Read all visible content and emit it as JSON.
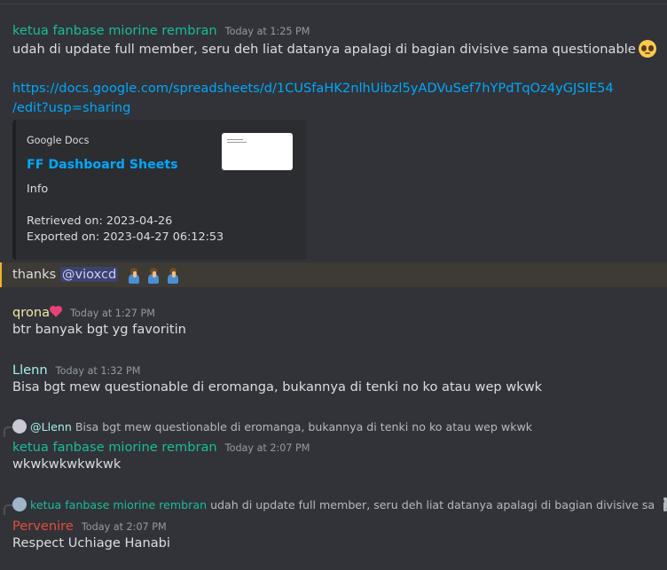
{
  "colors": {
    "background": "#313338",
    "teal_name": "#1abc9c",
    "qrona_name": "#f5e6a8",
    "llenn_name": "#a5f0f0",
    "pervenire_name": "#e74c3c",
    "link": "#00a8fc",
    "mention_highlight": "#f0b232"
  },
  "messages": [
    {
      "author": "ketua fanbase miorine rembran",
      "timestamp": "Today at 1:25 PM",
      "text": "udah di update full member, seru deh liat datanya apalagi di bagian divisive sama questionable",
      "emoji": "pleading-face",
      "link_line1": "https://docs.google.com/spreadsheets/d/1CUSfaHK2nlhUibzl5yADVuSef7hYPdTqOz4yGJSIE54",
      "link_line2": "/edit?usp=sharing",
      "embed": {
        "provider": "Google Docs",
        "title": "FF Dashboard Sheets",
        "description": "Info",
        "retrieved": "Retrieved on: 2023-04-26",
        "exported": "Exported on: 2023-04-27 06:12:53"
      },
      "follow_text": "thanks",
      "mention": "@vioxcd",
      "follow_emoji": "person-praying ×3"
    },
    {
      "author": "qrona",
      "author_emoji": "two-hearts",
      "timestamp": "Today at 1:27 PM",
      "text": "btr banyak bgt yg favoritin"
    },
    {
      "author": "Llenn",
      "timestamp": "Today at 1:32 PM",
      "text": "Bisa bgt mew questionable di eromanga, bukannya di tenki no ko atau wep wkwk"
    },
    {
      "reply_to": {
        "author": "@Llenn",
        "text": "Bisa bgt mew questionable di eromanga, bukannya di tenki no ko atau wep wkwk"
      },
      "author": "ketua fanbase miorine rembran",
      "timestamp": "Today at 2:07 PM",
      "text": "wkwkwkwkwkwk"
    },
    {
      "reply_to": {
        "author": "ketua fanbase miorine rembran",
        "text": "udah di update full member, seru deh liat datanya apalagi di bagian divisive sa",
        "icon": "image-icon"
      },
      "author": "Pervenire",
      "timestamp": "Today at 2:07 PM",
      "text": "Respect Uchiage Hanabi"
    }
  ]
}
